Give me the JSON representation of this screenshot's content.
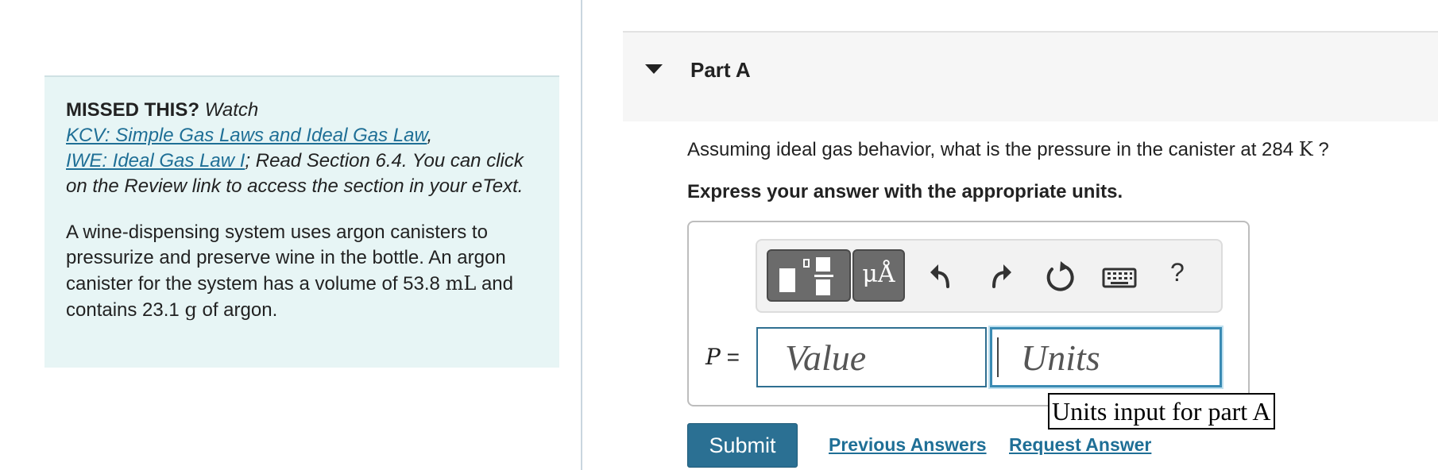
{
  "sidebar": {
    "missed_label": "MISSED THIS?",
    "watch_text": "Watch",
    "link1": "KCV: Simple Gas Laws and Ideal Gas Law",
    "comma": ",",
    "link2": "IWE: Ideal Gas Law I",
    "read_text": "; Read Section 6.4. You can click on the Review link to access the section in your eText.",
    "problem_part1": "A wine-dispensing system uses argon canisters to pressurize and preserve wine in the bottle. An argon canister for the system has a volume of 53.8",
    "unit_ml": "mL",
    "problem_part2": "and contains 23.1",
    "unit_g": "g",
    "problem_part3": "of argon."
  },
  "part": {
    "title": "Part A",
    "question_text": "Assuming ideal gas behavior, what is the pressure in the canister at 284",
    "question_unit": "K",
    "question_mark": "?",
    "instruction": "Express your answer with the appropriate units."
  },
  "toolbar": {
    "units_glyph": "μÅ",
    "help": "?"
  },
  "answer": {
    "variable": "P",
    "equals": " =",
    "value_placeholder": "Value",
    "units_placeholder": "Units",
    "tooltip": "Units input for part A"
  },
  "actions": {
    "submit": "Submit",
    "previous_answers": "Previous Answers",
    "request_answer": "Request Answer"
  }
}
